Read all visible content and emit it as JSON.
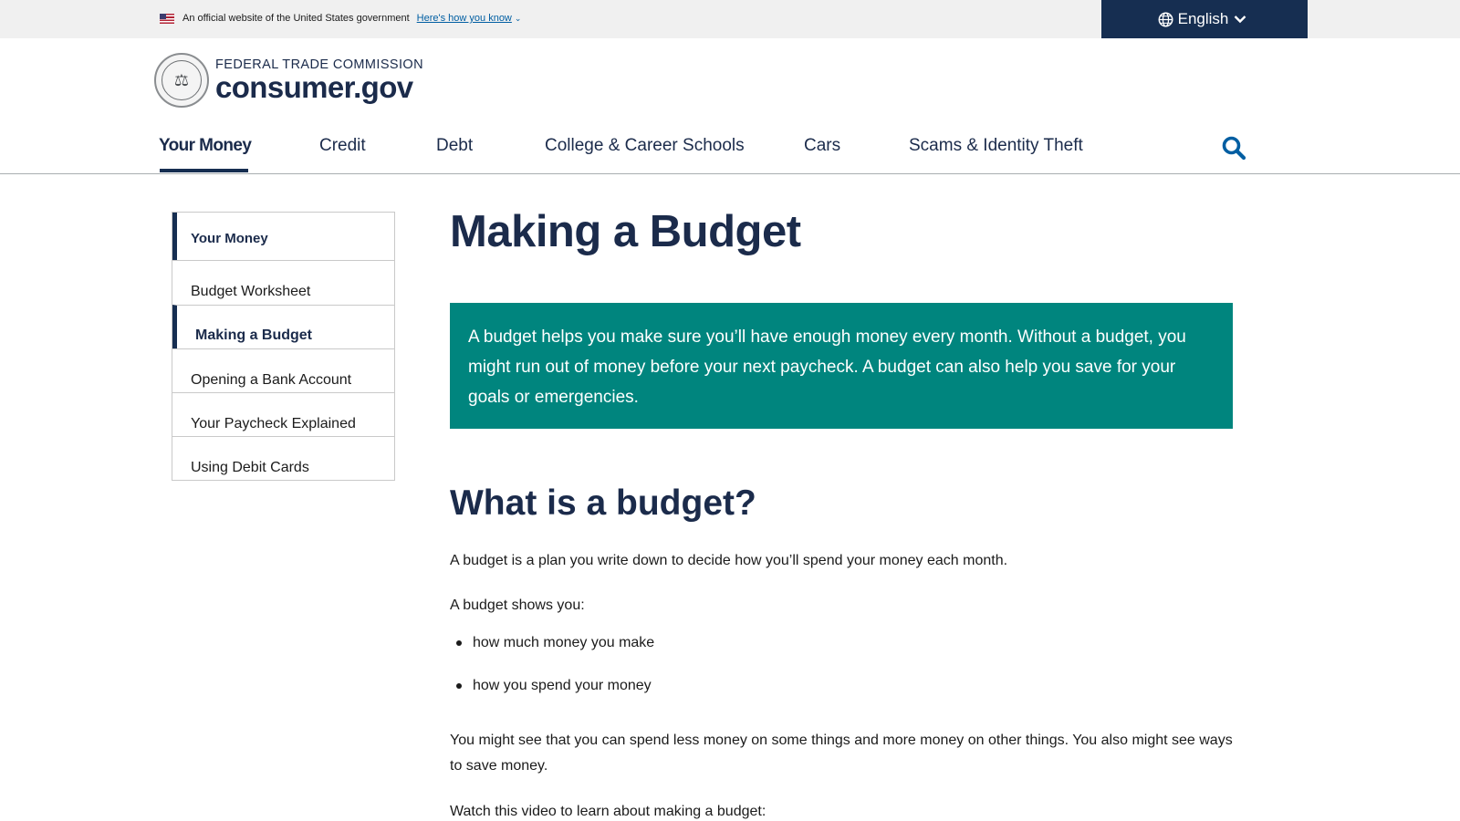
{
  "gov_banner": {
    "official_text": "An official website of the United States government",
    "how_you_know": "Here's how you know"
  },
  "language": {
    "label": "English"
  },
  "logo": {
    "agency": "FEDERAL TRADE COMMISSION",
    "site": "consumer.gov"
  },
  "nav": {
    "items": [
      {
        "label": "Your Money",
        "active": true
      },
      {
        "label": "Credit"
      },
      {
        "label": "Debt"
      },
      {
        "label": "College & Career Schools"
      },
      {
        "label": "Cars"
      },
      {
        "label": "Scams & Identity Theft"
      }
    ]
  },
  "sidebar": {
    "heading": "Your Money",
    "items": [
      {
        "label": "Budget Worksheet"
      },
      {
        "label": "Making a Budget",
        "current": true
      },
      {
        "label": "Opening a Bank Account"
      },
      {
        "label": "Your Paycheck Explained"
      },
      {
        "label": "Using Debit Cards"
      }
    ]
  },
  "content": {
    "title": "Making a Budget",
    "intro": "A budget helps you make sure you’ll have enough money every month. Without a budget, you might run out of money before your next paycheck. A budget can also help you save for your goals or emergencies.",
    "section_heading": "What is a budget?",
    "p1": "A budget is a plan you write down to decide how you’ll spend your money each month.",
    "p2": "A budget shows you:",
    "bullets": [
      "how much money you make",
      "how you spend your money"
    ],
    "p3": "You might see that you can spend less money on some things and more money on other things. You also might see ways to save money.",
    "p4": "Watch this video to learn about making a budget:"
  },
  "colors": {
    "navy": "#162e51",
    "teal": "#00857e",
    "link": "#005ea2",
    "banner_bg": "#f0f0f0"
  },
  "icons": [
    "us-flag-icon",
    "chevron-down-icon",
    "globe-icon",
    "ftc-seal-icon",
    "search-icon"
  ]
}
